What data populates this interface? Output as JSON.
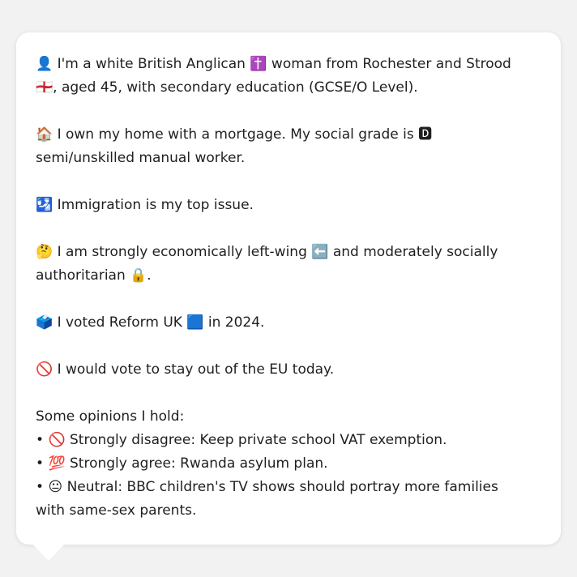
{
  "paragraphs": [
    {
      "emoji": "👤",
      "text": "I'm a white British Anglican ✝️ woman from Rochester and Strood 🏴󠁧󠁢󠁥󠁮󠁧󠁿, aged 45, with secondary education (GCSE/O Level)."
    },
    {
      "emoji": "🏠",
      "text": "I own my home with a mortgage. My social grade is 🅳 semi/unskilled manual worker."
    },
    {
      "emoji": "🛂",
      "text": "Immigration is my top issue."
    },
    {
      "emoji": "🤔",
      "text": "I am strongly economically left-wing ⬅️ and moderately socially authoritarian 🔒."
    },
    {
      "emoji": "🗳️",
      "text": "I voted Reform UK 🟦 in 2024."
    },
    {
      "emoji": "🚫",
      "text": "I would vote to stay out of the EU today."
    }
  ],
  "opinions": {
    "heading": "Some opinions I hold:",
    "items": [
      {
        "bullet": "•",
        "emoji": "🚫",
        "text": "Strongly disagree: Keep private school VAT exemption."
      },
      {
        "bullet": "•",
        "emoji": "💯",
        "text": "Strongly agree: Rwanda asylum plan."
      },
      {
        "bullet": "•",
        "emoji": "😐",
        "text": "Neutral: BBC children's TV shows should portray more families with same-sex parents."
      }
    ]
  }
}
